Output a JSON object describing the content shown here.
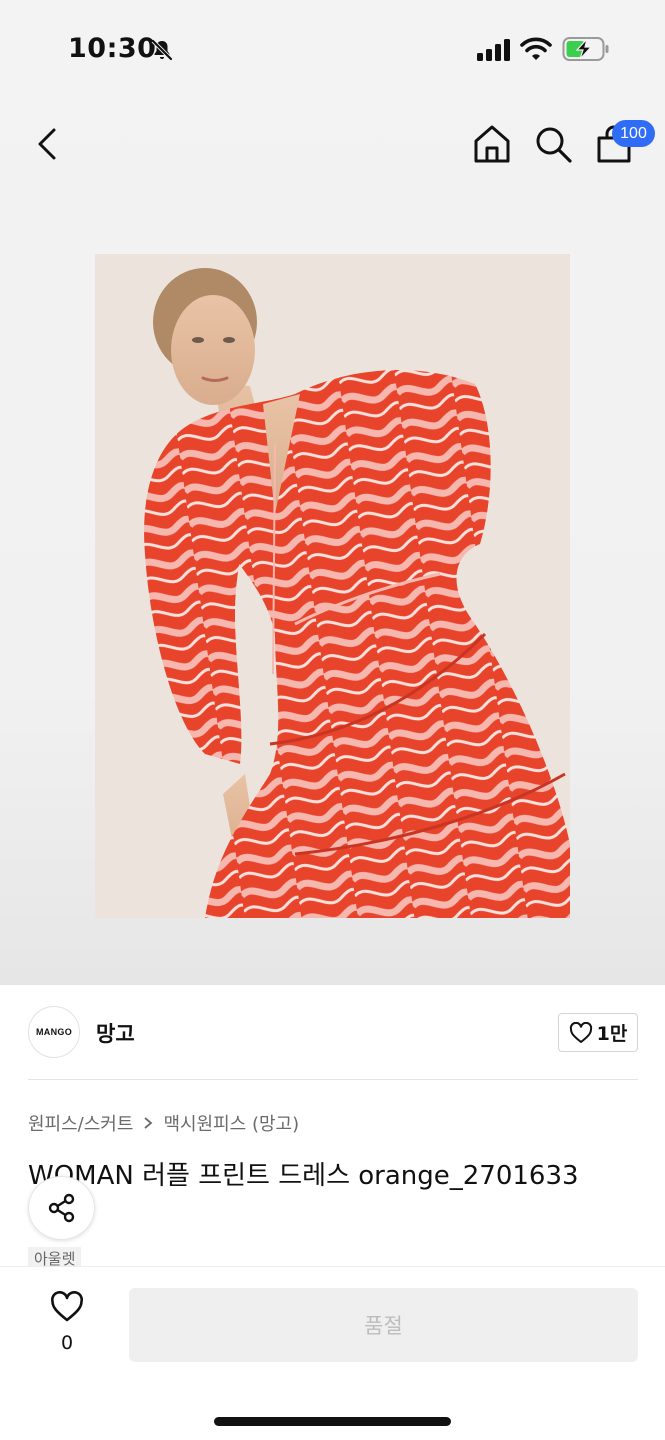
{
  "status_bar": {
    "time": "10:30",
    "icons": [
      "bell-off-icon",
      "signal-icon",
      "wifi-icon",
      "battery-charging-icon"
    ]
  },
  "nav": {
    "icons": [
      "back-icon",
      "home-icon",
      "search-icon",
      "shopping-bag-icon"
    ],
    "cart_count": "100"
  },
  "product": {
    "image_alt": "WOMAN 러플 프린트 드레스 orange_2701633",
    "brand_logo_text": "MANGO",
    "brand_name": "망고",
    "brand_likes": "1만",
    "breadcrumb": [
      "원피스/스커트",
      "맥시원피스 (망고)"
    ],
    "title": "WOMAN 러플 프린트 드레스 orange_2701633",
    "tag": "아울렛"
  },
  "bottom_bar": {
    "wish_count": "0",
    "soldout_label": "품절"
  },
  "colors": {
    "accent_badge": "#2f6df6",
    "dress_orange": "#e8432b",
    "dress_pink": "#f6b7ae",
    "photo_bg": "#ece4dc",
    "disabled_button": "#efefef"
  }
}
